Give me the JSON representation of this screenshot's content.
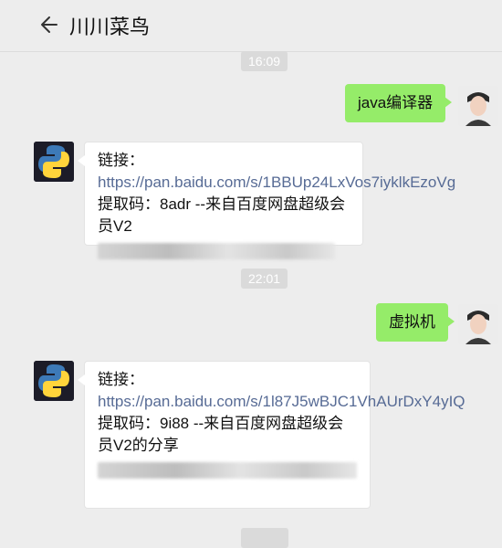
{
  "header": {
    "title": "川川菜鸟"
  },
  "messages": {
    "time1": "16:09",
    "self1": "java编译器",
    "bot1": {
      "prefix": "链接：",
      "url": "https://pan.baidu.com/s/1BBUp24LxVos7iyklkEzoVg",
      "suffix": " 提取码：8adr --来自百度网盘超级会员V2"
    },
    "time2": "22:01",
    "self2": "虚拟机",
    "bot2": {
      "prefix": "链接：",
      "url": "https://pan.baidu.com/s/1l87J5wBJC1VhAUrDxY4yIQ",
      "suffix": " 提取码：9i88 --来自百度网盘超级会员V2的分享"
    }
  },
  "colors": {
    "bubble_green": "#95ec69",
    "link": "#576b95",
    "background": "#ededed"
  }
}
